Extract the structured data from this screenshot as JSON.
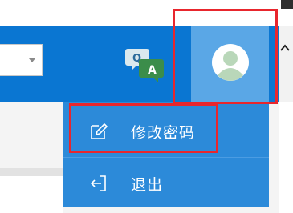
{
  "header": {
    "translate_icon": "translate-qa-icon",
    "avatar_icon": "user-avatar-icon",
    "collapse_icon": "chevron-up-icon"
  },
  "dropdown": {
    "items": [
      {
        "label": "修改密码",
        "icon": "edit-pencil-icon"
      },
      {
        "label": "退出",
        "icon": "logout-icon"
      }
    ]
  },
  "colors": {
    "header": "#0a76d2",
    "avatar_cell": "#5aa7e6",
    "dropdown": "#2c8ad9",
    "highlight": "#e8262d"
  }
}
